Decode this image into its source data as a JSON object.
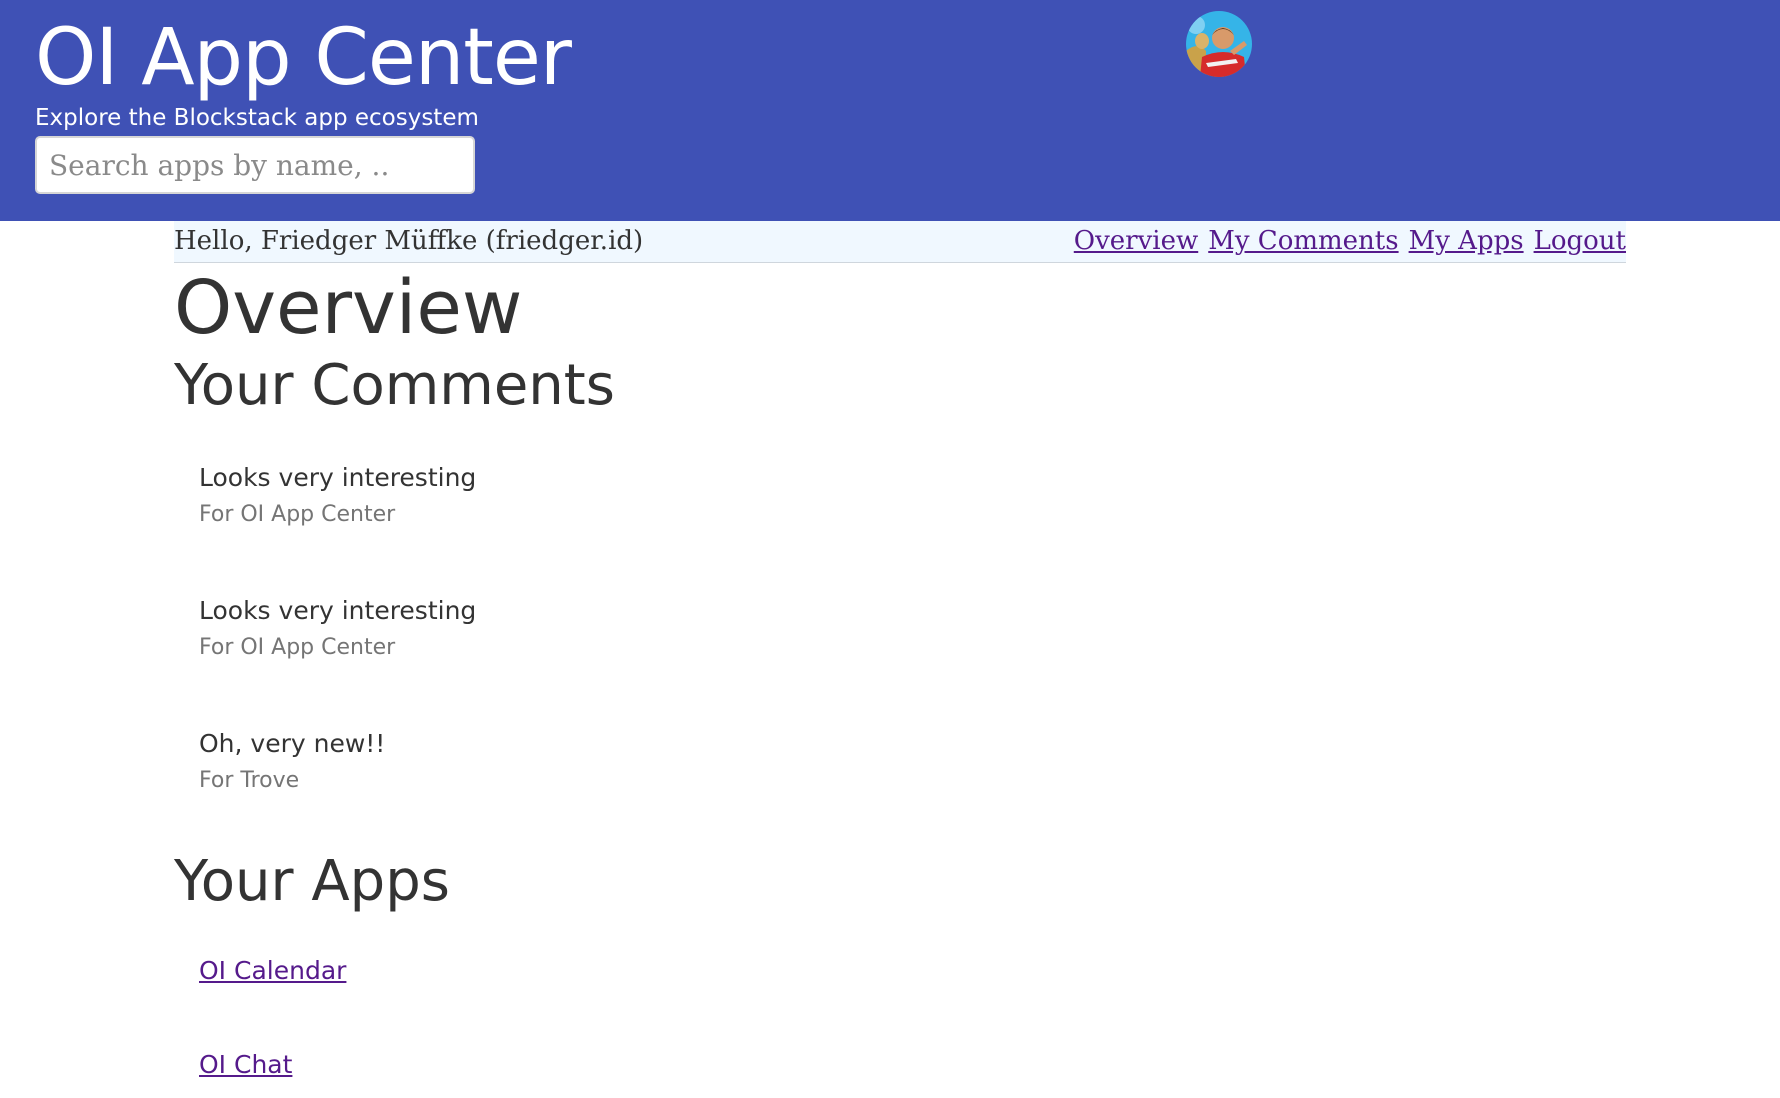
{
  "header": {
    "title": "OI App Center",
    "subtitle": "Explore the Blockstack app ecosystem",
    "search": {
      "placeholder": "Search apps by name, ..",
      "value": ""
    },
    "avatar_icon": "user-avatar-photo",
    "background_color": "#3f51b5"
  },
  "userbar": {
    "greeting": "Hello, Friedger Müffke (friedger.id)",
    "nav": [
      {
        "label": "Overview"
      },
      {
        "label": "My Comments"
      },
      {
        "label": "My Apps"
      },
      {
        "label": "Logout"
      }
    ]
  },
  "main": {
    "heading": "Overview",
    "comments_section": {
      "heading": "Your Comments",
      "items": [
        {
          "text": "Looks very interesting",
          "for": "For OI App Center"
        },
        {
          "text": "Looks very interesting",
          "for": "For OI App Center"
        },
        {
          "text": "Oh, very new!!",
          "for": "For Trove"
        }
      ]
    },
    "apps_section": {
      "heading": "Your Apps",
      "items": [
        {
          "label": "OI Calendar"
        },
        {
          "label": "OI Chat"
        }
      ]
    }
  }
}
